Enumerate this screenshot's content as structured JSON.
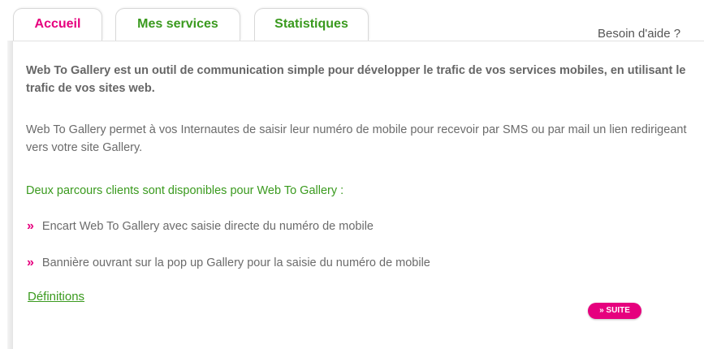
{
  "tabs": [
    {
      "label": "Accueil",
      "active": true
    },
    {
      "label": "Mes services",
      "active": false
    },
    {
      "label": "Statistiques",
      "active": false
    }
  ],
  "help_link": "Besoin d'aide ?",
  "content": {
    "intro": "Web To Gallery est un outil de communication simple pour développer le trafic de vos services mobiles, en utilisant le trafic de vos sites web.",
    "description": "Web To Gallery permet à vos Internautes de saisir leur numéro de mobile pour recevoir par SMS ou par mail un lien redirigeant vers votre site Gallery.",
    "paths_title": "Deux parcours clients sont disponibles pour Web To Gallery :",
    "bullets": [
      "Encart Web To Gallery avec saisie directe du numéro de mobile",
      "Bannière ouvrant sur la pop up Gallery pour la saisie du numéro de mobile"
    ],
    "bullet_glyph": "»",
    "definitions_link": "Définitions",
    "suite_button": "» SUITE"
  },
  "colors": {
    "accent_pink": "#e6007e",
    "accent_green": "#3a9a1e",
    "text_gray": "#6b6b6b"
  }
}
